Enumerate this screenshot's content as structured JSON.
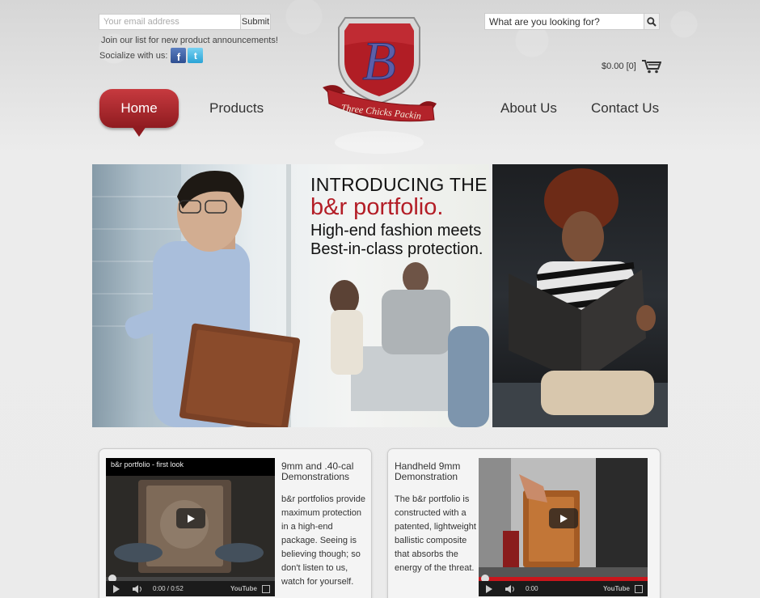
{
  "newsletter": {
    "email_placeholder": "Your email address",
    "submit_label": "Submit",
    "join_text": "Join our list for new product announcements!",
    "socialize_label": "Socialize with us:",
    "facebook_glyph": "f",
    "twitter_glyph": "t"
  },
  "logo": {
    "monogram": "B",
    "ribbon_text": "Three Chicks Packin"
  },
  "search": {
    "placeholder": "What are you looking for?"
  },
  "cart": {
    "summary": "$0.00 [0]"
  },
  "nav": {
    "items": [
      {
        "label": "Home",
        "active": true
      },
      {
        "label": "Products"
      },
      {
        "label": "About Us"
      },
      {
        "label": "Contact Us"
      }
    ]
  },
  "hero": {
    "line1": "INTRODUCING THE",
    "line2": "b&r portfolio.",
    "line3": "High-end fashion meets",
    "line4": "Best-in-class protection."
  },
  "cards": [
    {
      "video_title": "b&r portfolio - first look",
      "time": "0:00 / 0:52",
      "youtube": "YouTube",
      "title": "9mm and .40-cal Demonstrations",
      "body": "b&r portfolios provide maximum protection in a high-end package. Seeing is believing though; so don't listen to us, watch for yourself."
    },
    {
      "time": "0:00",
      "youtube": "YouTube",
      "title": "Handheld 9mm Demonstration",
      "body": "The b&r portfolio is constructed with a patented, lightweight ballistic composite that absorbs the energy of the threat."
    }
  ],
  "colors": {
    "brand_red": "#b31d26",
    "nav_active": "#a8262b"
  }
}
